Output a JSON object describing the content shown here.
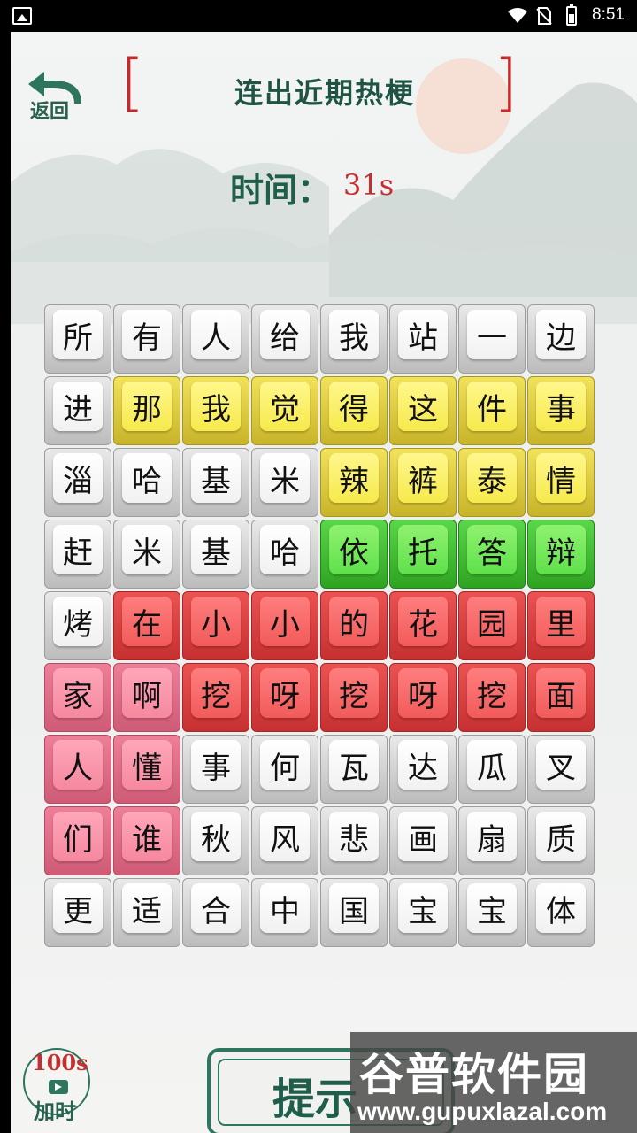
{
  "status_bar": {
    "time": "8:51"
  },
  "header": {
    "back_label": "返回",
    "title": "连出近期热梗",
    "timer_label": "时间：",
    "timer_value": "31s"
  },
  "grid": {
    "rows": 9,
    "cols": 8,
    "tiles": [
      [
        "所",
        "有",
        "人",
        "给",
        "我",
        "站",
        "一",
        "边"
      ],
      [
        "进",
        "那",
        "我",
        "觉",
        "得",
        "这",
        "件",
        "事"
      ],
      [
        "淄",
        "哈",
        "基",
        "米",
        "辣",
        "裤",
        "泰",
        "情"
      ],
      [
        "赶",
        "米",
        "基",
        "哈",
        "依",
        "托",
        "答",
        "辩"
      ],
      [
        "烤",
        "在",
        "小",
        "小",
        "的",
        "花",
        "园",
        "里"
      ],
      [
        "家",
        "啊",
        "挖",
        "呀",
        "挖",
        "呀",
        "挖",
        "面"
      ],
      [
        "人",
        "懂",
        "事",
        "何",
        "瓦",
        "达",
        "瓜",
        "叉"
      ],
      [
        "们",
        "谁",
        "秋",
        "风",
        "悲",
        "画",
        "扇",
        "质"
      ],
      [
        "更",
        "适",
        "合",
        "中",
        "国",
        "宝",
        "宝",
        "体"
      ]
    ],
    "colors": [
      [
        "white",
        "white",
        "white",
        "white",
        "white",
        "white",
        "white",
        "white"
      ],
      [
        "white",
        "yellow",
        "yellow",
        "yellow",
        "yellow",
        "yellow",
        "yellow",
        "yellow"
      ],
      [
        "white",
        "white",
        "white",
        "white",
        "yellow",
        "yellow",
        "yellow",
        "yellow"
      ],
      [
        "white",
        "white",
        "white",
        "white",
        "green",
        "green",
        "green",
        "green"
      ],
      [
        "white",
        "red",
        "red",
        "red",
        "red",
        "red",
        "red",
        "red"
      ],
      [
        "pink",
        "pink",
        "red",
        "red",
        "red",
        "red",
        "red",
        "red"
      ],
      [
        "pink",
        "pink",
        "white",
        "white",
        "white",
        "white",
        "white",
        "white"
      ],
      [
        "pink",
        "pink",
        "white",
        "white",
        "white",
        "white",
        "white",
        "white"
      ],
      [
        "white",
        "white",
        "white",
        "white",
        "white",
        "white",
        "white",
        "white"
      ]
    ]
  },
  "footer": {
    "video_seconds": "100s",
    "video_label": "加时",
    "hint_label": "提示"
  },
  "watermark": {
    "main": "谷普软件园",
    "url": "www.gupuxlazal.com"
  },
  "colors": {
    "accent_green": "#1e5e4a",
    "accent_red": "#c43030"
  }
}
